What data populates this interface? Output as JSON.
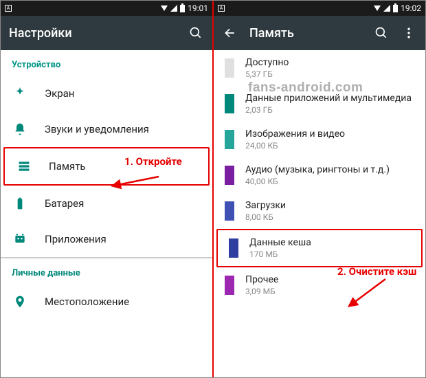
{
  "left": {
    "status_time": "19:01",
    "title": "Настройки",
    "section_device": "Устройство",
    "items": {
      "display": "Экран",
      "sounds": "Звуки и уведомления",
      "memory": "Память",
      "battery": "Батарея",
      "apps": "Приложения"
    },
    "section_personal": "Личные данные",
    "location": "Местоположение",
    "annotation1": "1. Откройте"
  },
  "right": {
    "status_time": "19:02",
    "title": "Память",
    "items": {
      "available": {
        "label": "Доступно",
        "sub": "5,37 ГБ",
        "color": "#e0e0e0"
      },
      "apps": {
        "label": "Данные приложений и мультимедиа",
        "sub": "2,03 ГБ",
        "color": "#00897b"
      },
      "images": {
        "label": "Изображения и видео",
        "sub": "24,00 КБ",
        "color": "#26a69a"
      },
      "audio": {
        "label": "Аудио (музыка, рингтоны и т.д.)",
        "sub": "40,00 КБ",
        "color": "#7b1fa2"
      },
      "downloads": {
        "label": "Загрузки",
        "sub": "8,00 КБ",
        "color": "#3f51b5"
      },
      "cache": {
        "label": "Данные кеша",
        "sub": "170 МБ",
        "color": "#303f9f"
      },
      "other": {
        "label": "Прочее",
        "sub": "3,09 МБ",
        "color": "#9c27b0"
      }
    },
    "annotation2": "2. Очистите кэш"
  },
  "watermark": "fans-android.com"
}
